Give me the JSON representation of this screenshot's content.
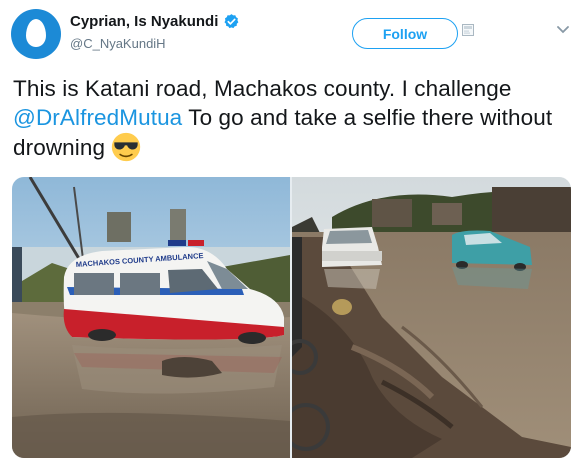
{
  "author": {
    "display_name": "Cyprian, Is Nyakundi",
    "handle": "@C_NyaKundiH",
    "verified": true,
    "avatar_icon": "default-egg-avatar-icon"
  },
  "actions": {
    "follow_label": "Follow"
  },
  "tweet": {
    "text_part1": "This is Katani road, Machakos county. I challenge ",
    "mention": "@DrAlfredMutua",
    "text_part2": " To go and take a selfie there without drowning ",
    "emoji": "smiling-face-with-sunglasses"
  },
  "media": {
    "photos": [
      {
        "ambulance_label": "MACHAKOS COUNTY AMBULANCE",
        "icon": "flooded-road-ambulance-photo"
      },
      {
        "icon": "muddy-road-cars-photo"
      }
    ]
  },
  "colors": {
    "accent": "#1da1f2",
    "mention": "#1b95e0",
    "verified": "#1da1f2",
    "handle_gray": "#657786"
  }
}
